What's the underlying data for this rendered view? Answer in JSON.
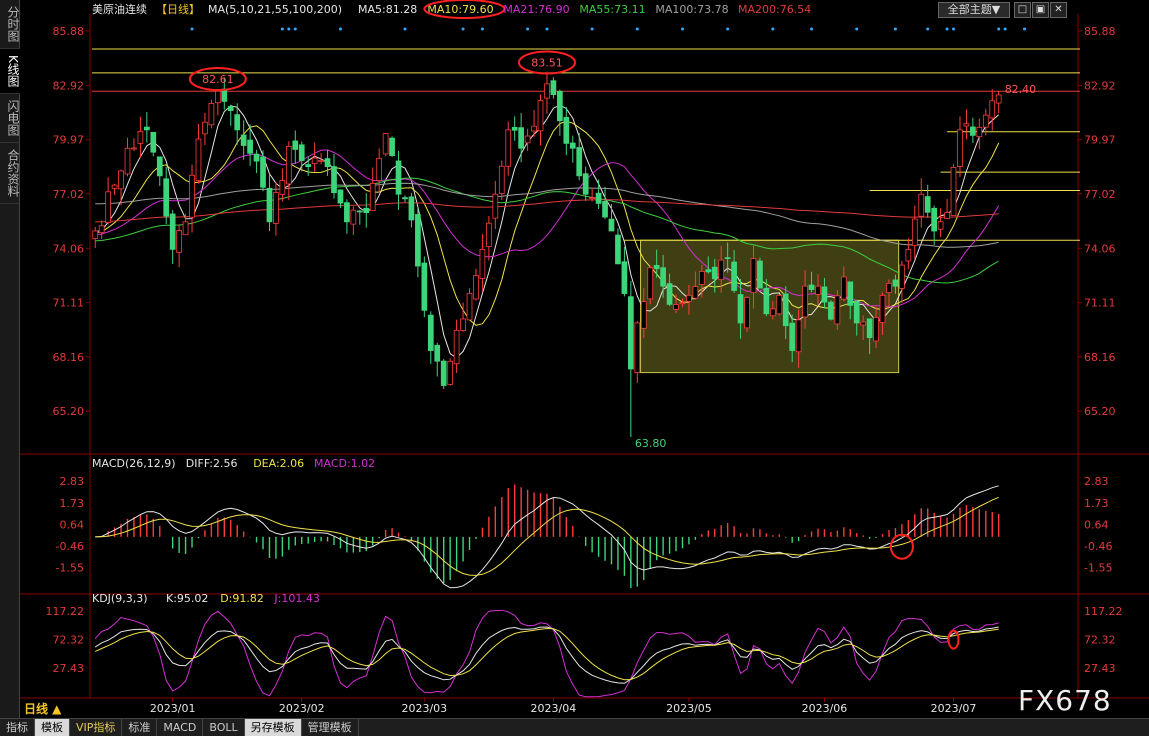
{
  "left_tabs": [
    "分时图",
    "K线图",
    "闪电图",
    "合约资料"
  ],
  "active_left_tab": 1,
  "header": {
    "instrument": "美原油连续",
    "period_tag": "【日线】",
    "ma_label": "MA(5,10,21,55,100,200)",
    "ma_values": [
      {
        "text": "MA5:81.28",
        "color": "#e6e6e6"
      },
      {
        "text": "MA10:79.60",
        "color": "#f0e14a"
      },
      {
        "text": "MA21:76.90",
        "color": "#d22fd2"
      },
      {
        "text": "MA55:73.11",
        "color": "#3ecf3e"
      },
      {
        "text": "MA100:73.78",
        "color": "#a0a0a0"
      },
      {
        "text": "MA200:76.54",
        "color": "#e23a3a"
      }
    ],
    "theme_button": "全部主题▼",
    "minimize_glyph": "□",
    "restore_glyph": "▣",
    "close_glyph": "✕"
  },
  "bottom_tabs": [
    {
      "label": "指标",
      "active": false,
      "vip": false
    },
    {
      "label": "模板",
      "active": true,
      "vip": false
    },
    {
      "label": "VIP指标",
      "active": false,
      "vip": true
    },
    {
      "label": "标准",
      "active": false,
      "vip": false
    },
    {
      "label": "MACD",
      "active": false,
      "vip": false
    },
    {
      "label": "BOLL",
      "active": false,
      "vip": false
    },
    {
      "label": "另存模板",
      "active": true,
      "vip": false
    },
    {
      "label": "管理模板",
      "active": false,
      "vip": false
    }
  ],
  "period_label": "日线 ▲",
  "watermark": "FX678",
  "chart_data": {
    "type": "candlestick",
    "price_ticks": [
      "85.88",
      "82.92",
      "79.97",
      "77.02",
      "74.06",
      "71.11",
      "68.16",
      "65.20"
    ],
    "price_range": [
      63.2,
      86.8
    ],
    "x_labels": [
      "2023/01",
      "2023/02",
      "2023/03",
      "2023/04",
      "2023/05",
      "2023/06",
      "2023/07"
    ],
    "x_label_index": [
      12,
      32,
      51,
      71,
      92,
      113,
      133
    ],
    "total_bars": 150,
    "price_anchors": [
      [
        0,
        75.0
      ],
      [
        3,
        77.5
      ],
      [
        5,
        79.5
      ],
      [
        8,
        80.5
      ],
      [
        10,
        78.0
      ],
      [
        12,
        74.0
      ],
      [
        14,
        75.5
      ],
      [
        16,
        80.0
      ],
      [
        19,
        82.6
      ],
      [
        22,
        80.5
      ],
      [
        25,
        78.8
      ],
      [
        27,
        75.5
      ],
      [
        30,
        79.6
      ],
      [
        33,
        78.5
      ],
      [
        36,
        78.5
      ],
      [
        39,
        75.5
      ],
      [
        42,
        76.0
      ],
      [
        45,
        80.3
      ],
      [
        47,
        77.0
      ],
      [
        49,
        75.6
      ],
      [
        52,
        68.5
      ],
      [
        54,
        66.6
      ],
      [
        56,
        69.6
      ],
      [
        58,
        71.6
      ],
      [
        60,
        74.0
      ],
      [
        62,
        77.0
      ],
      [
        64,
        80.5
      ],
      [
        66,
        79.5
      ],
      [
        68,
        80.7
      ],
      [
        70,
        83.0
      ],
      [
        72,
        81.0
      ],
      [
        74,
        79.5
      ],
      [
        76,
        77.0
      ],
      [
        78,
        76.5
      ],
      [
        80,
        75.0
      ],
      [
        82,
        71.6
      ],
      [
        83,
        67.5
      ],
      [
        84,
        70.0
      ],
      [
        86,
        73.0
      ],
      [
        88,
        72.0
      ],
      [
        90,
        71.0
      ],
      [
        92,
        71.5
      ],
      [
        94,
        72.8
      ],
      [
        96,
        72.4
      ],
      [
        98,
        73.5
      ],
      [
        100,
        70.0
      ],
      [
        102,
        73.5
      ],
      [
        104,
        70.5
      ],
      [
        106,
        71.5
      ],
      [
        108,
        68.5
      ],
      [
        110,
        72.0
      ],
      [
        112,
        72.0
      ],
      [
        114,
        70.2
      ],
      [
        116,
        72.5
      ],
      [
        118,
        70.0
      ],
      [
        120,
        69.2
      ],
      [
        122,
        71.5
      ],
      [
        124,
        72.0
      ],
      [
        126,
        74.0
      ],
      [
        128,
        77.0
      ],
      [
        130,
        75.0
      ],
      [
        132,
        76.0
      ],
      [
        134,
        80.5
      ],
      [
        136,
        80.2
      ],
      [
        138,
        81.3
      ],
      [
        140,
        82.4
      ]
    ],
    "last_close": 82.4,
    "moving_averages": [
      {
        "name": "MA5",
        "period": 5,
        "color": "#e6e6e6",
        "value": 81.28
      },
      {
        "name": "MA10",
        "period": 10,
        "color": "#f0e14a",
        "value": 79.6
      },
      {
        "name": "MA21",
        "period": 21,
        "color": "#d22fd2",
        "value": 76.9
      },
      {
        "name": "MA55",
        "period": 55,
        "color": "#3ecf3e",
        "value": 73.11
      },
      {
        "name": "MA100",
        "period": 100,
        "color": "#a0a0a0",
        "value": 73.78
      },
      {
        "name": "MA200",
        "period": 200,
        "color": "#e23a3a",
        "value": 76.54
      }
    ],
    "annotations": [
      {
        "text": "82.61",
        "bar": 19,
        "price": 82.61,
        "circled": true
      },
      {
        "text": "83.51",
        "bar": 70,
        "price": 83.51,
        "circled": true
      },
      {
        "text": "63.80",
        "bar": 83,
        "price": 63.8,
        "circled": false
      },
      {
        "text": "82.40",
        "bar": 140,
        "price": 82.4,
        "circled": false
      }
    ],
    "horizontal_lines": [
      {
        "price": 84.9,
        "color": "#f0e14a"
      },
      {
        "price": 83.6,
        "color": "#f0e14a"
      },
      {
        "price": 82.6,
        "color": "#e23a3a"
      },
      {
        "price": 80.4,
        "color": "#f0e14a",
        "from_bar": 132
      },
      {
        "price": 78.2,
        "color": "#f0e14a",
        "from_bar": 131
      },
      {
        "price": 77.2,
        "color": "#f0e14a",
        "from_bar": 120
      },
      {
        "price": 74.5,
        "color": "#f0e14a",
        "from_bar": 82
      }
    ],
    "consolidation_box": {
      "from_bar": 85,
      "to_bar": 125,
      "high": 74.5,
      "low": 67.3,
      "color": "#8b8b2a"
    },
    "signal_dot_bars": [
      15,
      29,
      30,
      31,
      38,
      48,
      57,
      60,
      67,
      70,
      77,
      84,
      91,
      98,
      105,
      111,
      118,
      124,
      129,
      132,
      133,
      140,
      141,
      144
    ],
    "macd": {
      "label": "MACD(26,12,9)",
      "diff": "DIFF:2.56",
      "dea": "DEA:2.06",
      "macd": "MACD:1.02",
      "ticks": [
        "2.83",
        "1.73",
        "0.64",
        "-0.46",
        "-1.55"
      ],
      "range": [
        -2.6,
        3.4
      ]
    },
    "kdj": {
      "label": "KDJ(9,3,3)",
      "k": "K:95.02",
      "d": "D:91.82",
      "j": "J:101.43",
      "ticks": [
        "117.22",
        "72.32",
        "27.43"
      ],
      "range": [
        -20,
        128
      ]
    }
  }
}
